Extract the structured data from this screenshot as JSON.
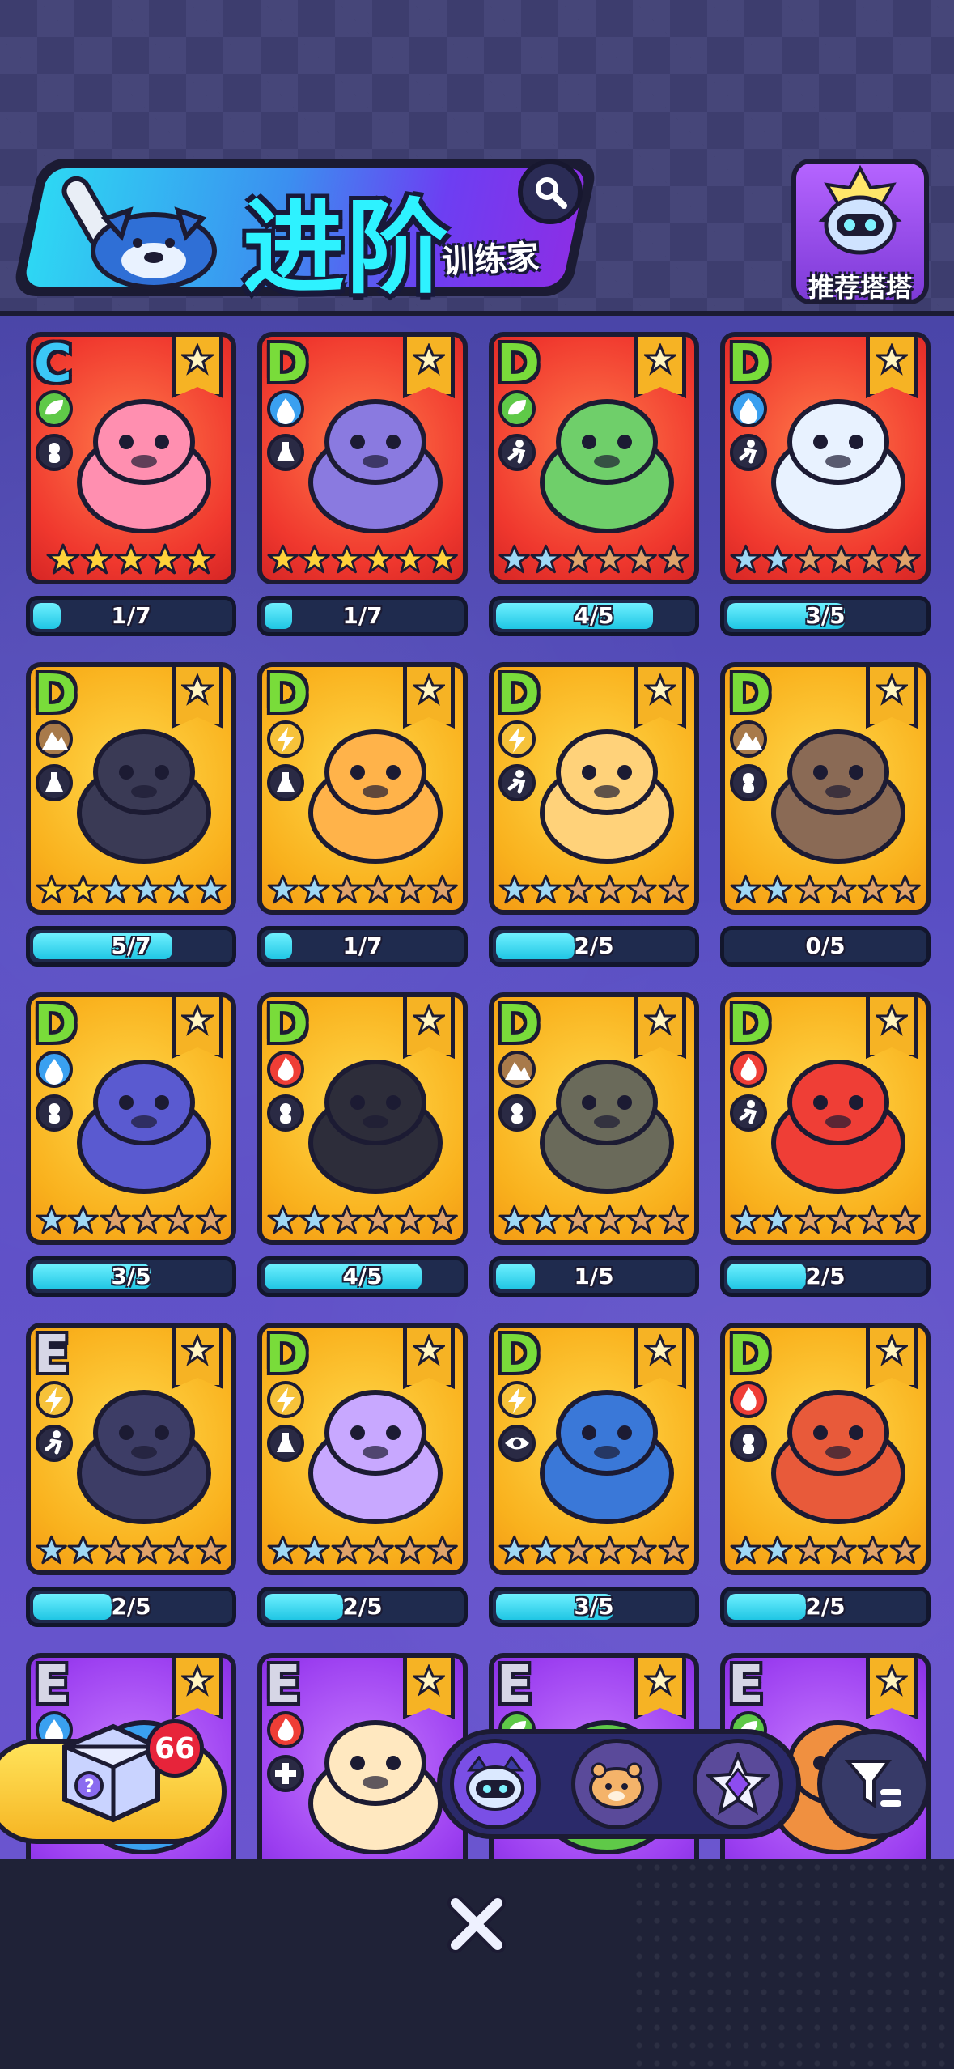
{
  "header": {
    "title": "进阶",
    "subtitle": "训练家",
    "recommend_label": "推荐塔塔"
  },
  "cards": [
    {
      "grade": "C",
      "element": "grass",
      "role": "support",
      "bg": "red",
      "stars_gold": 5,
      "stars_total": 5,
      "progress": "1/7",
      "fill": 0.14
    },
    {
      "grade": "D",
      "element": "water",
      "role": "potion",
      "bg": "red",
      "stars_gold": 6,
      "stars_total": 6,
      "progress": "1/7",
      "fill": 0.14
    },
    {
      "grade": "D",
      "element": "grass",
      "role": "runner",
      "bg": "red",
      "stars_gold": 0,
      "stars_total": 6,
      "progress": "4/5",
      "fill": 0.8
    },
    {
      "grade": "D",
      "element": "water",
      "role": "runner",
      "bg": "red",
      "stars_gold": 0,
      "stars_total": 6,
      "progress": "3/5",
      "fill": 0.6
    },
    {
      "grade": "D",
      "element": "earth",
      "role": "potion",
      "bg": "yellow",
      "stars_gold": 2,
      "stars_total": 6,
      "progress": "5/7",
      "fill": 0.71
    },
    {
      "grade": "D",
      "element": "electric",
      "role": "potion",
      "bg": "yellow",
      "stars_gold": 0,
      "stars_total": 6,
      "progress": "1/7",
      "fill": 0.14
    },
    {
      "grade": "D",
      "element": "electric",
      "role": "runner",
      "bg": "yellow",
      "stars_gold": 0,
      "stars_total": 6,
      "progress": "2/5",
      "fill": 0.4
    },
    {
      "grade": "D",
      "element": "earth",
      "role": "support",
      "bg": "yellow",
      "stars_gold": 0,
      "stars_total": 6,
      "progress": "0/5",
      "fill": 0
    },
    {
      "grade": "D",
      "element": "water",
      "role": "support",
      "bg": "yellow",
      "stars_gold": 0,
      "stars_total": 6,
      "progress": "3/5",
      "fill": 0.6
    },
    {
      "grade": "D",
      "element": "fire",
      "role": "support",
      "bg": "yellow",
      "stars_gold": 0,
      "stars_total": 6,
      "progress": "4/5",
      "fill": 0.8
    },
    {
      "grade": "D",
      "element": "earth",
      "role": "support",
      "bg": "yellow",
      "stars_gold": 0,
      "stars_total": 6,
      "progress": "1/5",
      "fill": 0.2
    },
    {
      "grade": "D",
      "element": "fire",
      "role": "runner",
      "bg": "yellow",
      "stars_gold": 0,
      "stars_total": 6,
      "progress": "2/5",
      "fill": 0.4
    },
    {
      "grade": "E",
      "element": "electric",
      "role": "runner",
      "bg": "yellow",
      "stars_gold": 0,
      "stars_total": 6,
      "progress": "2/5",
      "fill": 0.4
    },
    {
      "grade": "D",
      "element": "electric",
      "role": "potion",
      "bg": "yellow",
      "stars_gold": 0,
      "stars_total": 6,
      "progress": "2/5",
      "fill": 0.4
    },
    {
      "grade": "D",
      "element": "electric",
      "role": "eye",
      "bg": "yellow",
      "stars_gold": 0,
      "stars_total": 6,
      "progress": "3/5",
      "fill": 0.6
    },
    {
      "grade": "D",
      "element": "fire",
      "role": "support",
      "bg": "yellow",
      "stars_gold": 0,
      "stars_total": 6,
      "progress": "2/5",
      "fill": 0.4
    },
    {
      "grade": "E",
      "element": "water",
      "role": "support",
      "bg": "purple",
      "stars_gold": 0,
      "stars_total": 0,
      "progress": "",
      "fill": 0
    },
    {
      "grade": "E",
      "element": "fire",
      "role": "healer",
      "bg": "purple",
      "stars_gold": 0,
      "stars_total": 0,
      "progress": "",
      "fill": 0
    },
    {
      "grade": "E",
      "element": "grass",
      "role": "support",
      "bg": "purple",
      "stars_gold": 0,
      "stars_total": 0,
      "progress": "",
      "fill": 0
    },
    {
      "grade": "E",
      "element": "grass",
      "role": "support",
      "bg": "purple",
      "stars_gold": 0,
      "stars_total": 0,
      "progress": "",
      "fill": 0
    }
  ],
  "gift": {
    "count": "66"
  },
  "colors": {
    "grass": "#5fc948",
    "water": "#3aa0f0",
    "earth": "#a87a4a",
    "electric": "#f6c23a",
    "fire": "#ef3e36"
  }
}
